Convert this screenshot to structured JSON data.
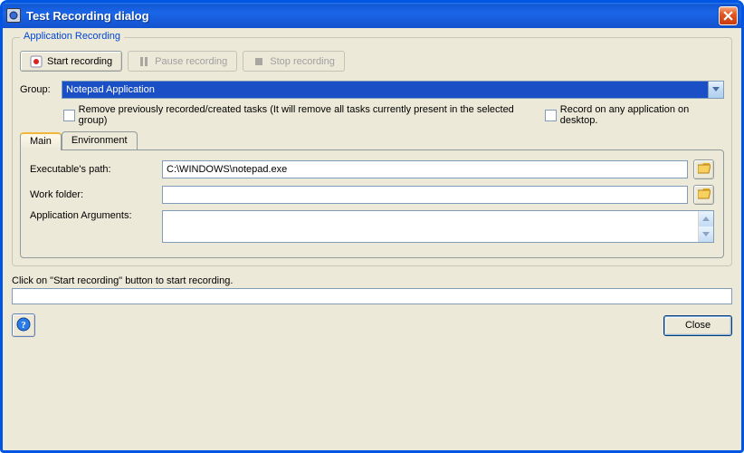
{
  "window": {
    "title": "Test Recording dialog"
  },
  "groupbox": {
    "legend": "Application Recording",
    "toolbar": {
      "start": "Start recording",
      "pause": "Pause recording",
      "stop": "Stop recording"
    },
    "group_label": "Group:",
    "group_value": "Notepad Application",
    "remove_chk": "Remove previously recorded/created tasks (It will remove all tasks currently present in the selected group)",
    "record_any_chk": "Record on any application on desktop."
  },
  "tabs": {
    "main": "Main",
    "env": "Environment"
  },
  "main_tab": {
    "exe_label": "Executable's path:",
    "exe_value": "C:\\WINDOWS\\notepad.exe",
    "work_label": "Work folder:",
    "work_value": "",
    "args_label": "Application Arguments:",
    "args_value": ""
  },
  "status": {
    "text": "Click on \"Start recording\" button to start recording."
  },
  "footer": {
    "close": "Close"
  }
}
